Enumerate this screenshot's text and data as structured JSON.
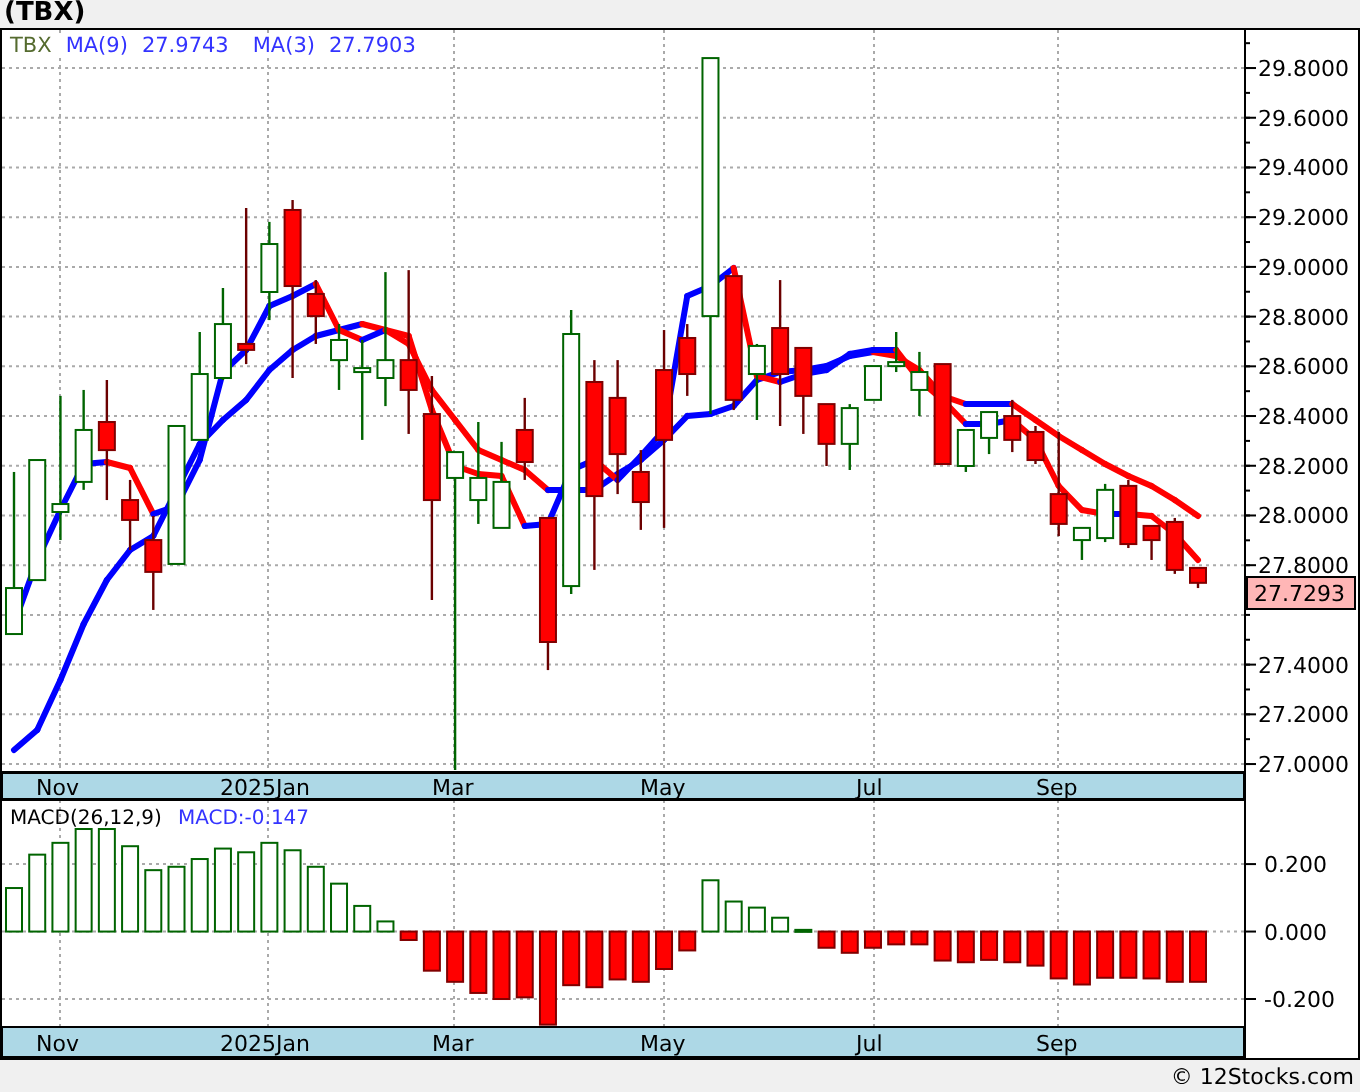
{
  "title": "(TBX)",
  "price_panel": {
    "symbol": "TBX",
    "moving_averages": [
      {
        "name": "MA(9)",
        "reading": "27.9743"
      },
      {
        "name": "MA(3)",
        "reading": "27.7903"
      }
    ],
    "last_price": "27.7293",
    "chart_data": {
      "type": "candlestick",
      "categories": [
        null,
        null,
        null,
        null,
        null,
        null,
        null,
        null,
        null,
        null,
        null,
        null,
        null,
        null,
        null,
        null,
        null,
        null,
        null,
        null,
        null,
        null,
        null,
        null,
        null,
        null,
        null,
        null,
        null,
        null,
        null,
        null,
        null,
        null,
        null,
        null,
        null,
        null,
        null,
        null,
        null,
        null,
        null,
        null,
        null,
        null,
        null,
        null,
        null,
        null,
        null,
        null
      ],
      "ohlc": [
        [
          27.523,
          28.175,
          27.523,
          27.708
        ],
        [
          27.74,
          28.223,
          27.74,
          28.223
        ],
        [
          28.014,
          28.481,
          27.901,
          28.046
        ],
        [
          28.135,
          28.505,
          28.103,
          28.344
        ],
        [
          28.376,
          28.545,
          28.062,
          28.263
        ],
        [
          28.062,
          28.143,
          27.861,
          27.982
        ],
        [
          27.901,
          27.998,
          27.62,
          27.773
        ],
        [
          27.805,
          28.36,
          27.805,
          28.36
        ],
        [
          28.304,
          28.738,
          28.304,
          28.569
        ],
        [
          28.553,
          28.915,
          28.545,
          28.77
        ],
        [
          28.69,
          29.237,
          28.609,
          28.666
        ],
        [
          28.899,
          29.181,
          28.786,
          29.092
        ],
        [
          29.229,
          29.269,
          28.553,
          28.923
        ],
        [
          28.891,
          28.947,
          28.69,
          28.802
        ],
        [
          28.625,
          28.77,
          28.505,
          28.706
        ],
        [
          28.577,
          28.706,
          28.304,
          28.593
        ],
        [
          28.553,
          28.979,
          28.44,
          28.625
        ],
        [
          28.625,
          28.987,
          28.328,
          28.505
        ],
        [
          28.408,
          28.561,
          27.66,
          28.062
        ],
        [
          28.151,
          28.255,
          26.976,
          28.255
        ],
        [
          28.062,
          28.376,
          27.966,
          28.151
        ],
        [
          27.95,
          28.296,
          27.95,
          28.135
        ],
        [
          28.344,
          28.473,
          28.143,
          28.215
        ],
        [
          27.99,
          27.99,
          27.378,
          27.491
        ],
        [
          27.716,
          28.827,
          27.684,
          28.73
        ],
        [
          28.537,
          28.625,
          27.781,
          28.078
        ],
        [
          28.473,
          28.625,
          28.086,
          28.247
        ],
        [
          28.175,
          28.263,
          27.942,
          28.054
        ],
        [
          28.585,
          28.746,
          27.95,
          28.304
        ],
        [
          28.714,
          28.77,
          28.481,
          28.569
        ],
        [
          28.802,
          29.84,
          28.408,
          29.84
        ],
        [
          28.963,
          28.963,
          28.424,
          28.465
        ],
        [
          28.569,
          28.69,
          28.384,
          28.682
        ],
        [
          28.754,
          28.947,
          28.36,
          28.569
        ],
        [
          28.674,
          28.674,
          28.328,
          28.481
        ],
        [
          28.448,
          28.448,
          28.199,
          28.288
        ],
        [
          28.288,
          28.448,
          28.183,
          28.432
        ],
        [
          28.465,
          28.601,
          28.465,
          28.601
        ],
        [
          28.601,
          28.738,
          28.577,
          28.617
        ],
        [
          28.505,
          28.658,
          28.4,
          28.577
        ],
        [
          28.609,
          28.609,
          28.207,
          28.207
        ],
        [
          28.199,
          28.344,
          28.175,
          28.344
        ],
        [
          28.312,
          28.416,
          28.247,
          28.416
        ],
        [
          28.4,
          28.465,
          28.255,
          28.304
        ],
        [
          28.336,
          28.36,
          28.207,
          28.223
        ],
        [
          28.086,
          28.336,
          27.917,
          27.966
        ],
        [
          27.901,
          27.95,
          27.821,
          27.95
        ],
        [
          27.909,
          28.127,
          27.893,
          28.103
        ],
        [
          28.119,
          28.143,
          27.869,
          27.885
        ],
        [
          27.958,
          27.958,
          27.821,
          27.901
        ],
        [
          27.974,
          27.99,
          27.765,
          27.781
        ],
        [
          27.789,
          27.789,
          27.708,
          27.729
        ]
      ],
      "ylim": [
        26.968,
        29.953
      ],
      "yticks": [
        {
          "value": 29.8,
          "label": "29.8000"
        },
        {
          "value": 29.6,
          "label": "29.6000"
        },
        {
          "value": 29.4,
          "label": "29.4000"
        },
        {
          "value": 29.2,
          "label": "29.2000"
        },
        {
          "value": 29.0,
          "label": "29.0000"
        },
        {
          "value": 28.8,
          "label": "28.8000"
        },
        {
          "value": 28.6,
          "label": "28.6000"
        },
        {
          "value": 28.4,
          "label": "28.4000"
        },
        {
          "value": 28.2,
          "label": "28.2000"
        },
        {
          "value": 28.0,
          "label": "28.0000"
        },
        {
          "value": 27.8,
          "label": "27.8000"
        },
        {
          "value": 27.4,
          "label": "27.4000"
        },
        {
          "value": 27.2,
          "label": "27.2000"
        },
        {
          "value": 27.0,
          "label": "27.0000"
        }
      ]
    },
    "x_labels": [
      "Nov",
      "2025Jan",
      "Mar",
      "May",
      "Jul",
      "Sep"
    ]
  },
  "macd_panel": {
    "reading": "MACD:-0.147",
    "chart_data": {
      "type": "bar",
      "title": "MACD(26,12,9)",
      "categories": [
        null,
        null,
        null,
        null,
        null,
        null,
        null,
        null,
        null,
        null,
        null,
        null,
        null,
        null,
        null,
        null,
        null,
        null,
        null,
        null,
        null,
        null,
        null,
        null,
        null,
        null,
        null,
        null,
        null,
        null,
        null,
        null,
        null,
        null,
        null,
        null,
        null,
        null,
        null,
        null,
        null,
        null,
        null,
        null,
        null,
        null,
        null,
        null,
        null,
        null,
        null,
        null
      ],
      "values": [
        0.129,
        0.228,
        0.263,
        0.304,
        0.304,
        0.253,
        0.182,
        0.192,
        0.215,
        0.246,
        0.235,
        0.263,
        0.241,
        0.192,
        0.142,
        0.076,
        0.03,
        -0.025,
        -0.116,
        -0.149,
        -0.182,
        -0.2,
        -0.195,
        -0.276,
        -0.159,
        -0.165,
        -0.142,
        -0.149,
        -0.111,
        -0.056,
        0.152,
        0.089,
        0.071,
        0.041,
        0.005,
        -0.048,
        -0.063,
        -0.048,
        -0.038,
        -0.038,
        -0.086,
        -0.091,
        -0.084,
        -0.091,
        -0.101,
        -0.139,
        -0.157,
        -0.137,
        -0.137,
        -0.139,
        -0.149,
        -0.149
      ],
      "ylim": [
        -0.28,
        0.39
      ],
      "yticks": [
        {
          "value": 0.2,
          "label": "0.200"
        },
        {
          "value": 0,
          "label": "0.000"
        },
        {
          "value": -0.2,
          "label": "-0.200"
        }
      ]
    },
    "x_labels": [
      "Nov",
      "2025Jan",
      "Mar",
      "May",
      "Jul",
      "Sep"
    ]
  },
  "footer": "© 12Stocks.com"
}
